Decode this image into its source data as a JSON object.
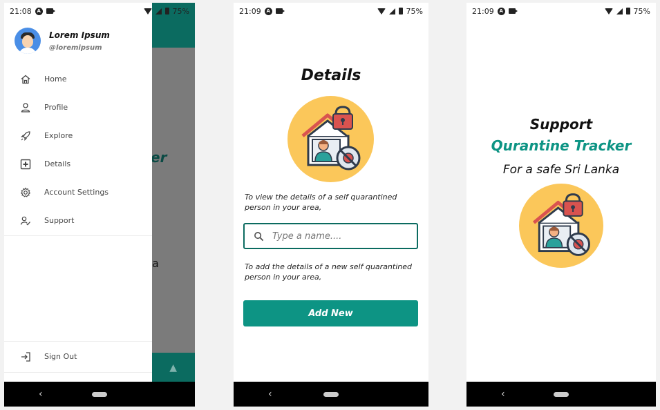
{
  "status_bars": {
    "phone1": {
      "time": "21:08",
      "battery": "75%"
    },
    "phone2": {
      "time": "21:09",
      "battery": "75%"
    },
    "phone3": {
      "time": "21:09",
      "battery": "75%"
    }
  },
  "drawer_screen": {
    "background": {
      "partial_title": "er",
      "partial_text": "a"
    },
    "user": {
      "name": "Lorem Ipsum",
      "handle": "@loremipsum"
    },
    "menu": [
      {
        "label": "Home",
        "icon": "home-icon"
      },
      {
        "label": "Profile",
        "icon": "person-icon"
      },
      {
        "label": "Explore",
        "icon": "rocket-icon"
      },
      {
        "label": "Details",
        "icon": "medical-plus-icon"
      },
      {
        "label": "Account Settings",
        "icon": "gear-icon"
      },
      {
        "label": "Support",
        "icon": "support-icon"
      }
    ],
    "sign_out": {
      "label": "Sign Out",
      "icon": "sign-out-icon"
    }
  },
  "details_screen": {
    "title": "Details",
    "view_text": "To view the details of a self quarantined person in your area,",
    "search_placeholder": "Type a name....",
    "add_text": "To add the details of a new self quarantined person in your area,",
    "add_button": "Add New"
  },
  "support_screen": {
    "line1": "Support",
    "line2": "Qurantine Tracker",
    "tagline": "For a safe Sri Lanka"
  },
  "colors": {
    "primary": "#0b6b60",
    "accent": "#0d9484",
    "illustration_bg": "#fbc75a"
  }
}
